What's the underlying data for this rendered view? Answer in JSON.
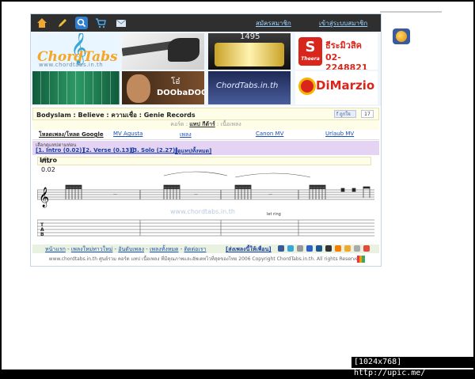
{
  "topbar": {
    "register_link": "สมัครสมาชิก",
    "login_link": "เข้าสู่ระบบสมาชิก",
    "icons": [
      "home-icon",
      "pencil-icon",
      "search-icon",
      "cart-icon",
      "mail-icon"
    ]
  },
  "banner": {
    "logo_text": "ChordTabs",
    "logo_url": "www.chordtabs.in.th",
    "drum_text": "1495",
    "theera_logo_letter": "S",
    "theera_logo_caption": "Theera",
    "theera_name": "ธีระมิวสิค",
    "theera_phone": "02-2248821",
    "doo_line1": "โอ๋",
    "doo_line2": "DOObaDOO",
    "stage_text": "ChordTabs.in.th",
    "dimarzio_name": "DiMarzio"
  },
  "song": {
    "title": "Bodyslam : Believe : ความเชื่อ : Genie Records",
    "like_label": "ถูกใจ",
    "like_count": "17",
    "chord_prefix": "คอร์ด :",
    "chord_name": "แทป กีต้าร์",
    "chord_suffix": ": เนื้อเพลง"
  },
  "nav": {
    "items": [
      "โหลดเพลง/โหลด Google",
      "MV Agusta",
      "เพลง",
      "Canon MV",
      "Urlaub MV"
    ]
  },
  "parts": {
    "label": "เลือกดูแทปตามท่อน",
    "items": [
      "[1. Intro (0.02)]",
      "[2. Verse (0.13)]",
      "[3. Solo (2.27)]",
      "[ดูแทปทั้งหมด]"
    ]
  },
  "intro": {
    "label": "Intro",
    "time": "เริ่ม 0.02"
  },
  "tab": {
    "watermark": "www.chordtabs.in.th",
    "let_ring": "let ring",
    "clef": "𝄞"
  },
  "footer": {
    "links": [
      "หน้าแรก",
      "เพลงใหม่ทาวใหม่",
      "อันดับเพลง",
      "เพลงทั้งหมด",
      "ติดต่อเรา"
    ],
    "share_label": "[ส่งเพลงนี้ให้เพื่อน]",
    "copyright": "www.chordtabs.in.th ศูนย์รวม คอร์ด แทป เนื้อเพลง ที่มีคุณภาพและอัพเดทไวที่สุดของไทย 2006 Copyright ChordTabs.in.th. All rights Reserved."
  },
  "stamp": "[1024x768] http://upic.me/"
}
